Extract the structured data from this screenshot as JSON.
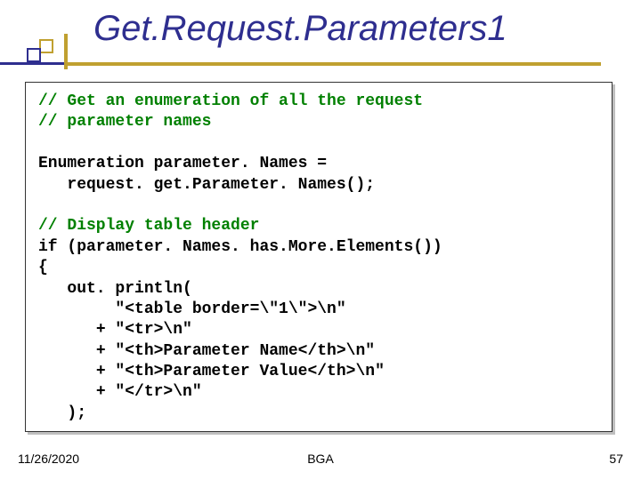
{
  "title": "Get.Request.Parameters1",
  "code": {
    "c1": "// Get an enumeration of all the request",
    "c2": "// parameter names",
    "l1": "Enumeration parameter. Names =",
    "l2": "   request. get.Parameter. Names();",
    "c3": "// Display table header",
    "l3": "if (parameter. Names. has.More.Elements())",
    "l4": "{",
    "l5": "   out. println(",
    "l6": "        \"<table border=\\\"1\\\">\\n\"",
    "l7": "      + \"<tr>\\n\"",
    "l8": "      + \"<th>Parameter Name</th>\\n\"",
    "l9": "      + \"<th>Parameter Value</th>\\n\"",
    "l10": "      + \"</tr>\\n\"",
    "l11": "   );"
  },
  "footer": {
    "date": "11/26/2020",
    "center": "BGA",
    "page": "57"
  }
}
